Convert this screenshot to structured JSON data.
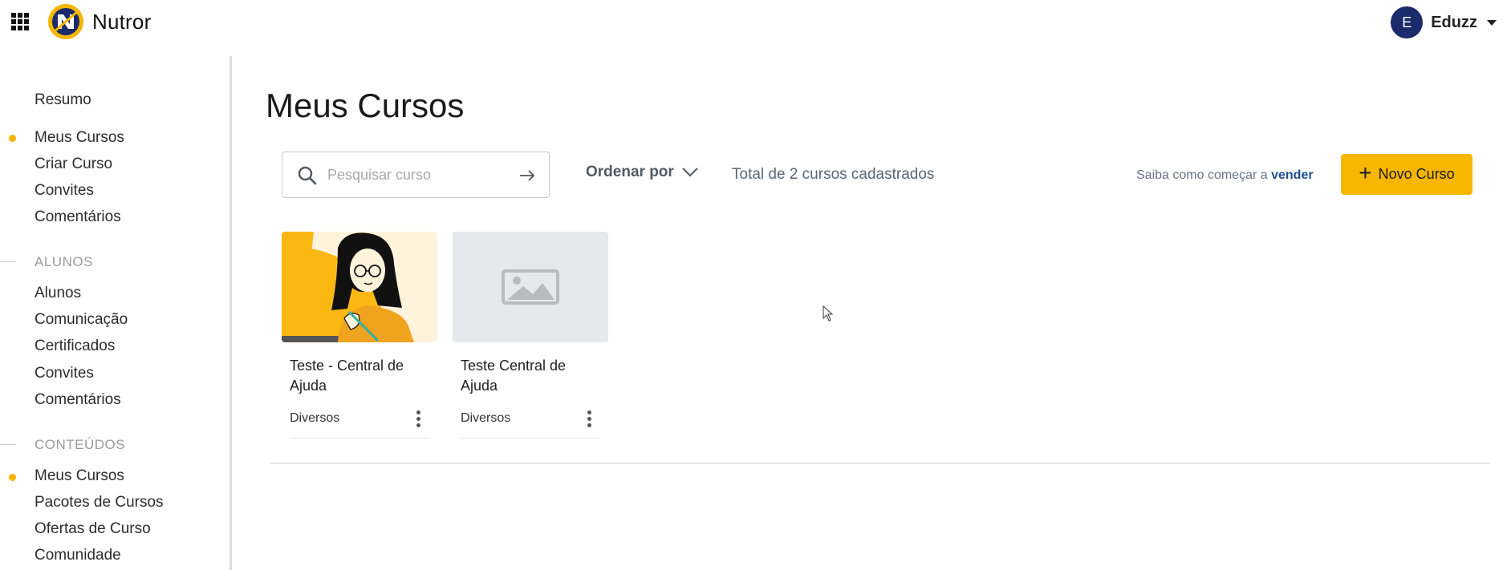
{
  "app": {
    "name": "Nutror",
    "brand_color": "#f7b600"
  },
  "user": {
    "initial": "E",
    "name": "Eduzz"
  },
  "sidebar": {
    "items": [
      {
        "label": "Resumo",
        "active": false
      },
      {
        "label": "Meus Cursos",
        "active": true
      },
      {
        "label": "Criar Curso",
        "active": false
      },
      {
        "label": "Convites",
        "active": false
      },
      {
        "label": "Comentários",
        "active": false
      }
    ],
    "sections": [
      {
        "title": "ALUNOS",
        "items": [
          {
            "label": "Alunos"
          },
          {
            "label": "Comunicação"
          },
          {
            "label": "Certificados"
          },
          {
            "label": "Convites"
          },
          {
            "label": "Comentários"
          }
        ]
      },
      {
        "title": "CONTEÚDOS",
        "items": [
          {
            "label": "Meus Cursos",
            "active": true
          },
          {
            "label": "Pacotes de Cursos"
          },
          {
            "label": "Ofertas de Curso"
          },
          {
            "label": "Comunidade"
          }
        ]
      }
    ]
  },
  "main": {
    "title": "Meus Cursos",
    "search": {
      "placeholder": "Pesquisar curso",
      "value": ""
    },
    "sort_label": "Ordenar por",
    "total_text": "Total de 2 cursos cadastrados",
    "learn_prefix": "Saiba como começar a",
    "learn_link": "vender",
    "new_button_label": "Novo Curso"
  },
  "courses": [
    {
      "title": "Teste - Central de Ajuda",
      "category": "Diversos",
      "thumbnail": "illustration-woman-glasses"
    },
    {
      "title": "Teste Central de Ajuda",
      "category": "Diversos",
      "thumbnail": "image-placeholder-icon"
    }
  ]
}
